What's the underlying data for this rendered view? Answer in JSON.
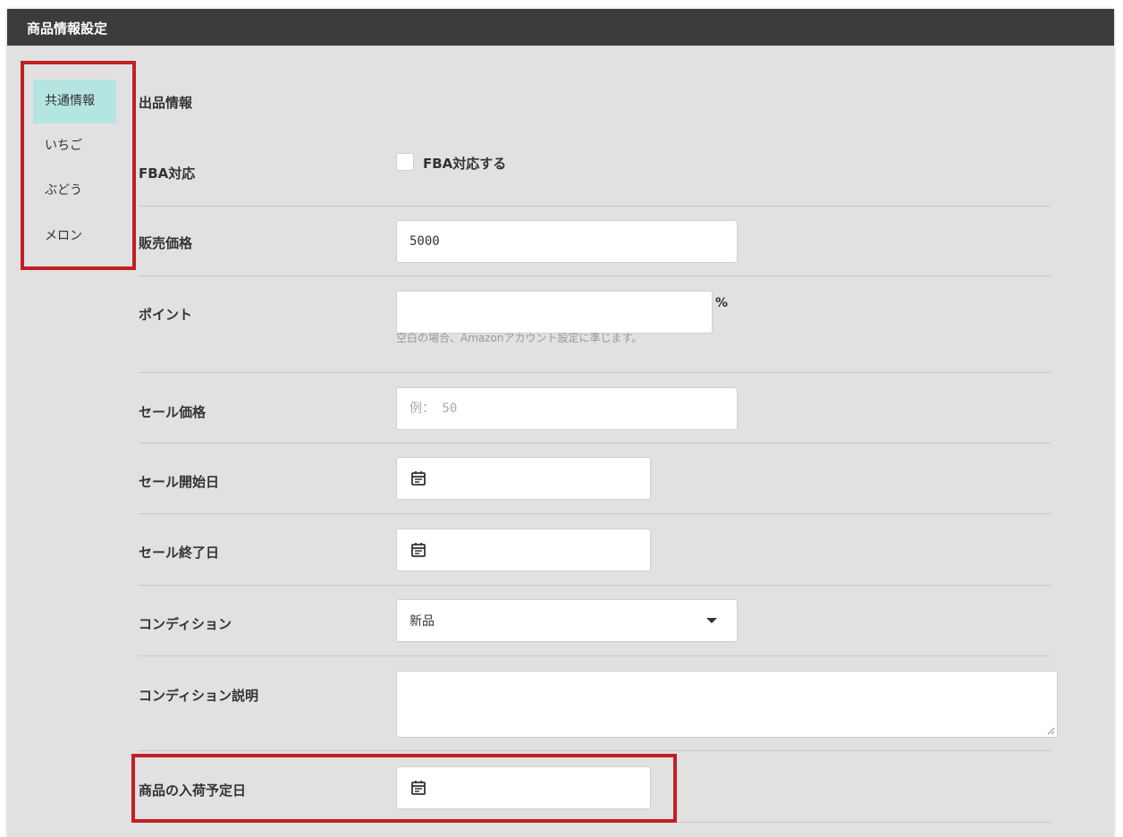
{
  "header": {
    "title": "商品情報設定"
  },
  "sidebar": {
    "items": [
      {
        "label": "共通情報",
        "active": true
      },
      {
        "label": "いちご",
        "active": false
      },
      {
        "label": "ぶどう",
        "active": false
      },
      {
        "label": "メロン",
        "active": false
      }
    ]
  },
  "section": {
    "title": "出品情報"
  },
  "form": {
    "fba": {
      "label": "FBA対応",
      "checkbox_label": "FBA対応する",
      "checked": false
    },
    "price": {
      "label": "販売価格",
      "value": "5000"
    },
    "point": {
      "label": "ポイント",
      "value": "",
      "unit": "%",
      "help": "空白の場合、Amazonアカウント設定に準じます。"
    },
    "sale_price": {
      "label": "セール価格",
      "placeholder": "例： 50"
    },
    "sale_start": {
      "label": "セール開始日",
      "icon": "calendar-icon"
    },
    "sale_end": {
      "label": "セール終了日",
      "icon": "calendar-icon"
    },
    "condition": {
      "label": "コンディション",
      "selected": "新品"
    },
    "condition_note": {
      "label": "コンディション説明",
      "value": ""
    },
    "arrival_date": {
      "label": "商品の入荷予定日",
      "icon": "calendar-icon"
    }
  },
  "colors": {
    "header_bg": "#3c3c3c",
    "panel_bg": "#e1e1e1",
    "active_tab": "#b5e5e1",
    "highlight": "#c21f24"
  }
}
